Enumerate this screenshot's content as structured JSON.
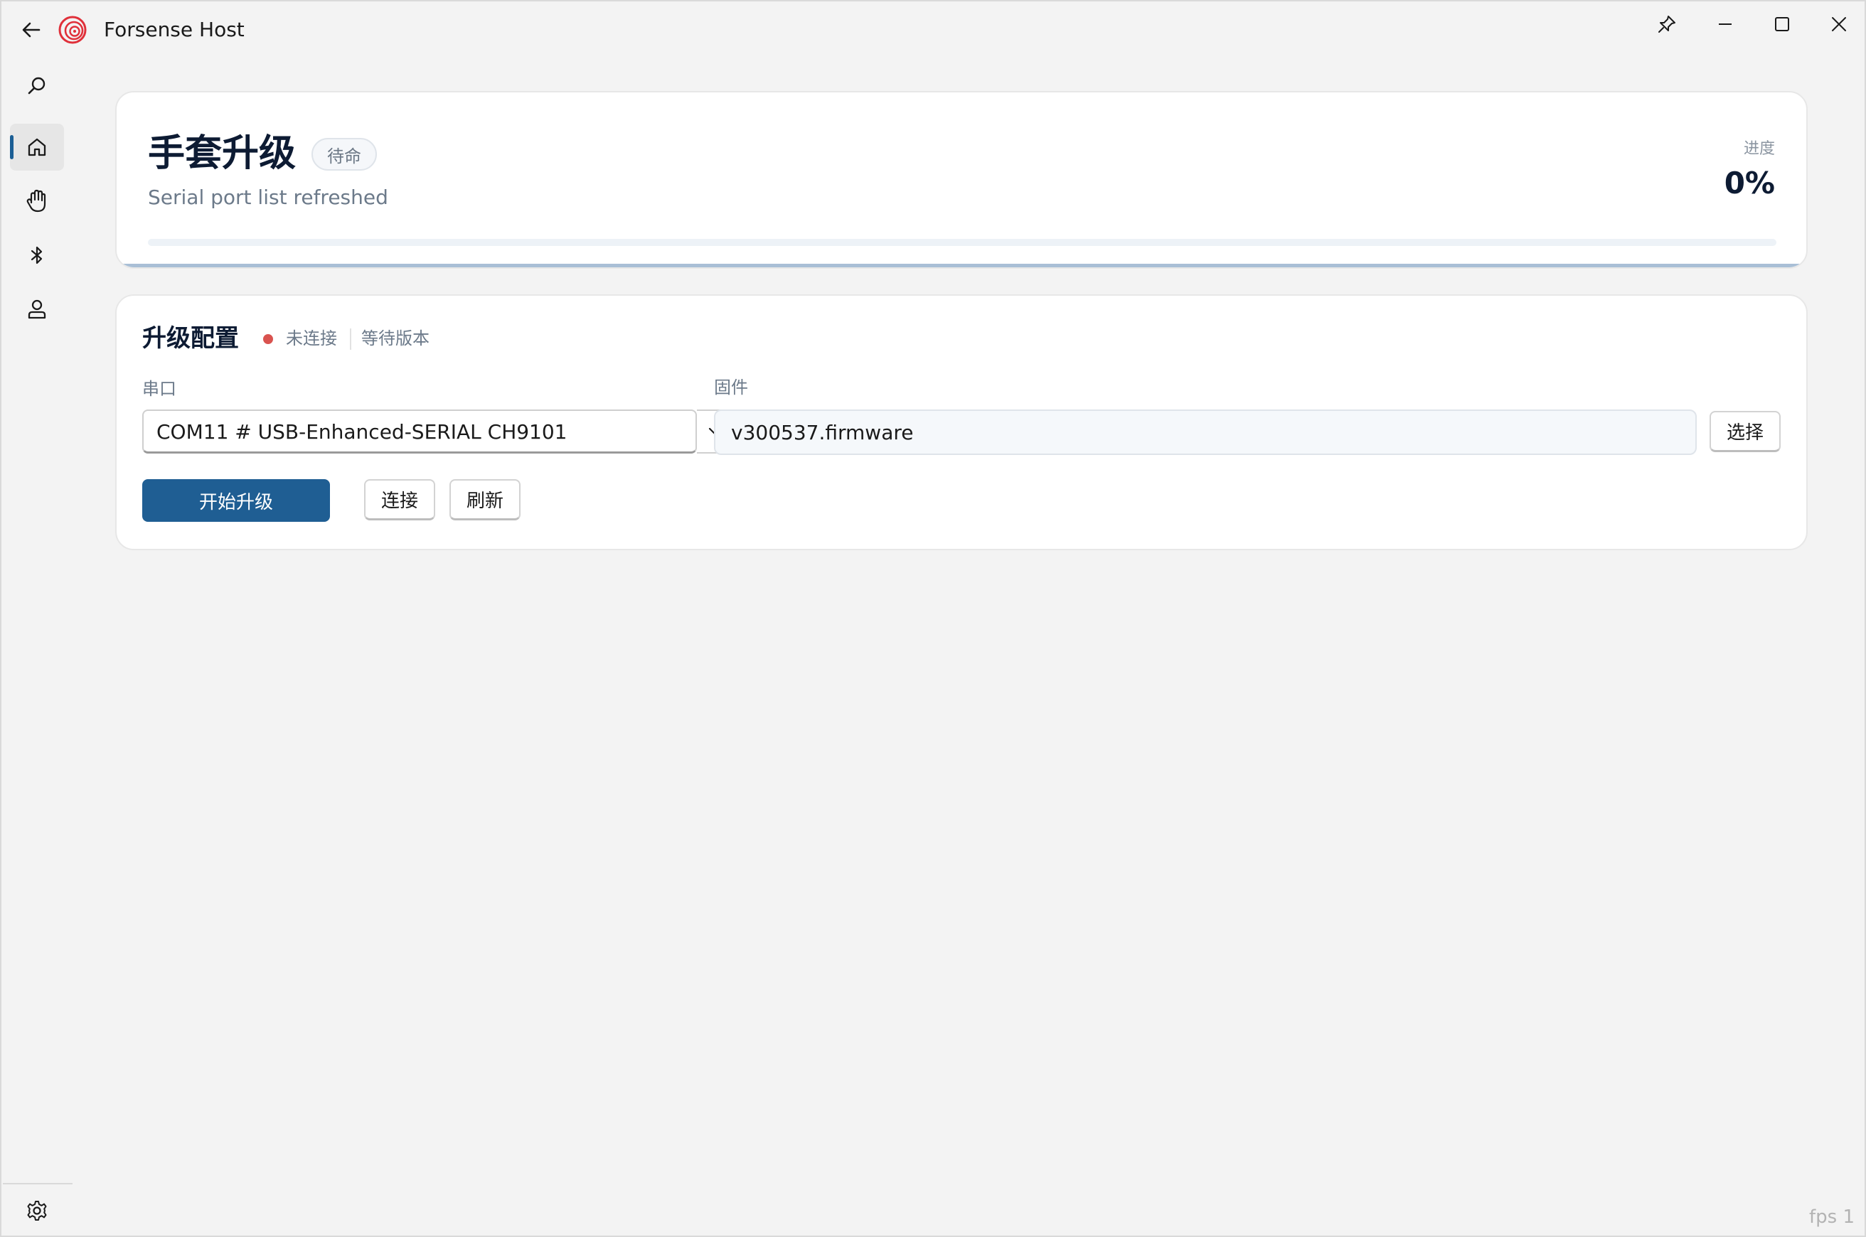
{
  "window": {
    "title": "Forsense Host",
    "fps_label": "fps 1"
  },
  "sidebar": {
    "items": [
      {
        "icon": "search-icon"
      },
      {
        "icon": "home-icon",
        "active": true
      },
      {
        "icon": "hand-icon"
      },
      {
        "icon": "bluetooth-icon"
      },
      {
        "icon": "user-icon"
      }
    ],
    "footer_icon": "settings-icon"
  },
  "status_card": {
    "title": "手套升级",
    "chip": "待命",
    "message": "Serial port list refreshed",
    "progress_label": "进度",
    "progress_value": "0%",
    "progress_fraction": 0
  },
  "config_card": {
    "title": "升级配置",
    "connection_status": "未连接",
    "version_status": "等待版本",
    "status_color": "#d9534f",
    "serial_label": "串口",
    "serial_selected": "COM11 # USB-Enhanced-SERIAL CH9101",
    "firmware_label": "固件",
    "firmware_value": "v300537.firmware",
    "choose_button": "选择",
    "start_button": "开始升级",
    "connect_button": "连接",
    "refresh_button": "刷新"
  },
  "colors": {
    "accent": "#1f5e93",
    "background": "#f3f3f3"
  }
}
